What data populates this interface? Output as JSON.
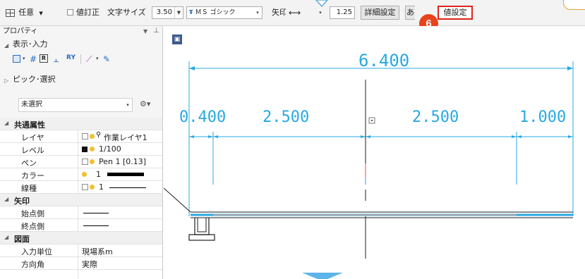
{
  "toolbar": {
    "mode_select": "任意",
    "value_correct_label": "値訂正",
    "text_size_label": "文字サイズ",
    "text_size_value": "3.50",
    "font_value": "ＭＳ ゴシック",
    "arrow_label": "矢印",
    "arrow_value": "1.25",
    "detail_settings_button": "詳細設定",
    "partial_button": "あ",
    "value_settings_button": "値設定",
    "font_icon": "font-type-icon"
  },
  "callout": {
    "number": "6",
    "color": "#e8431c"
  },
  "panel": {
    "title": "プロパティ",
    "section_display_input": "表示･入力",
    "section_pick_select": "ピック･選択",
    "selection_value": "未選択",
    "categories": {
      "common": "共通属性",
      "arrow": "矢印",
      "drawing": "図面"
    },
    "rows": {
      "layer": {
        "key": "レイヤ",
        "value": "作業レイヤ1"
      },
      "level": {
        "key": "レベル",
        "value": "1/100"
      },
      "pen": {
        "key": "ペン",
        "value": "Pen 1 [0.13]"
      },
      "color": {
        "key": "カラー",
        "value": "1"
      },
      "linetype": {
        "key": "線種",
        "value": "1"
      },
      "start_side": {
        "key": "始点側"
      },
      "end_side": {
        "key": "終点側"
      },
      "input_unit": {
        "key": "入力単位",
        "value": "現場系m"
      },
      "direction": {
        "key": "方向角",
        "value": "実際"
      }
    }
  },
  "canvas": {
    "overall_dimension": "6.400",
    "dimensions": [
      "0.400",
      "2.500",
      "2.500",
      "1.000"
    ],
    "accent_color": "#27a9e1"
  }
}
